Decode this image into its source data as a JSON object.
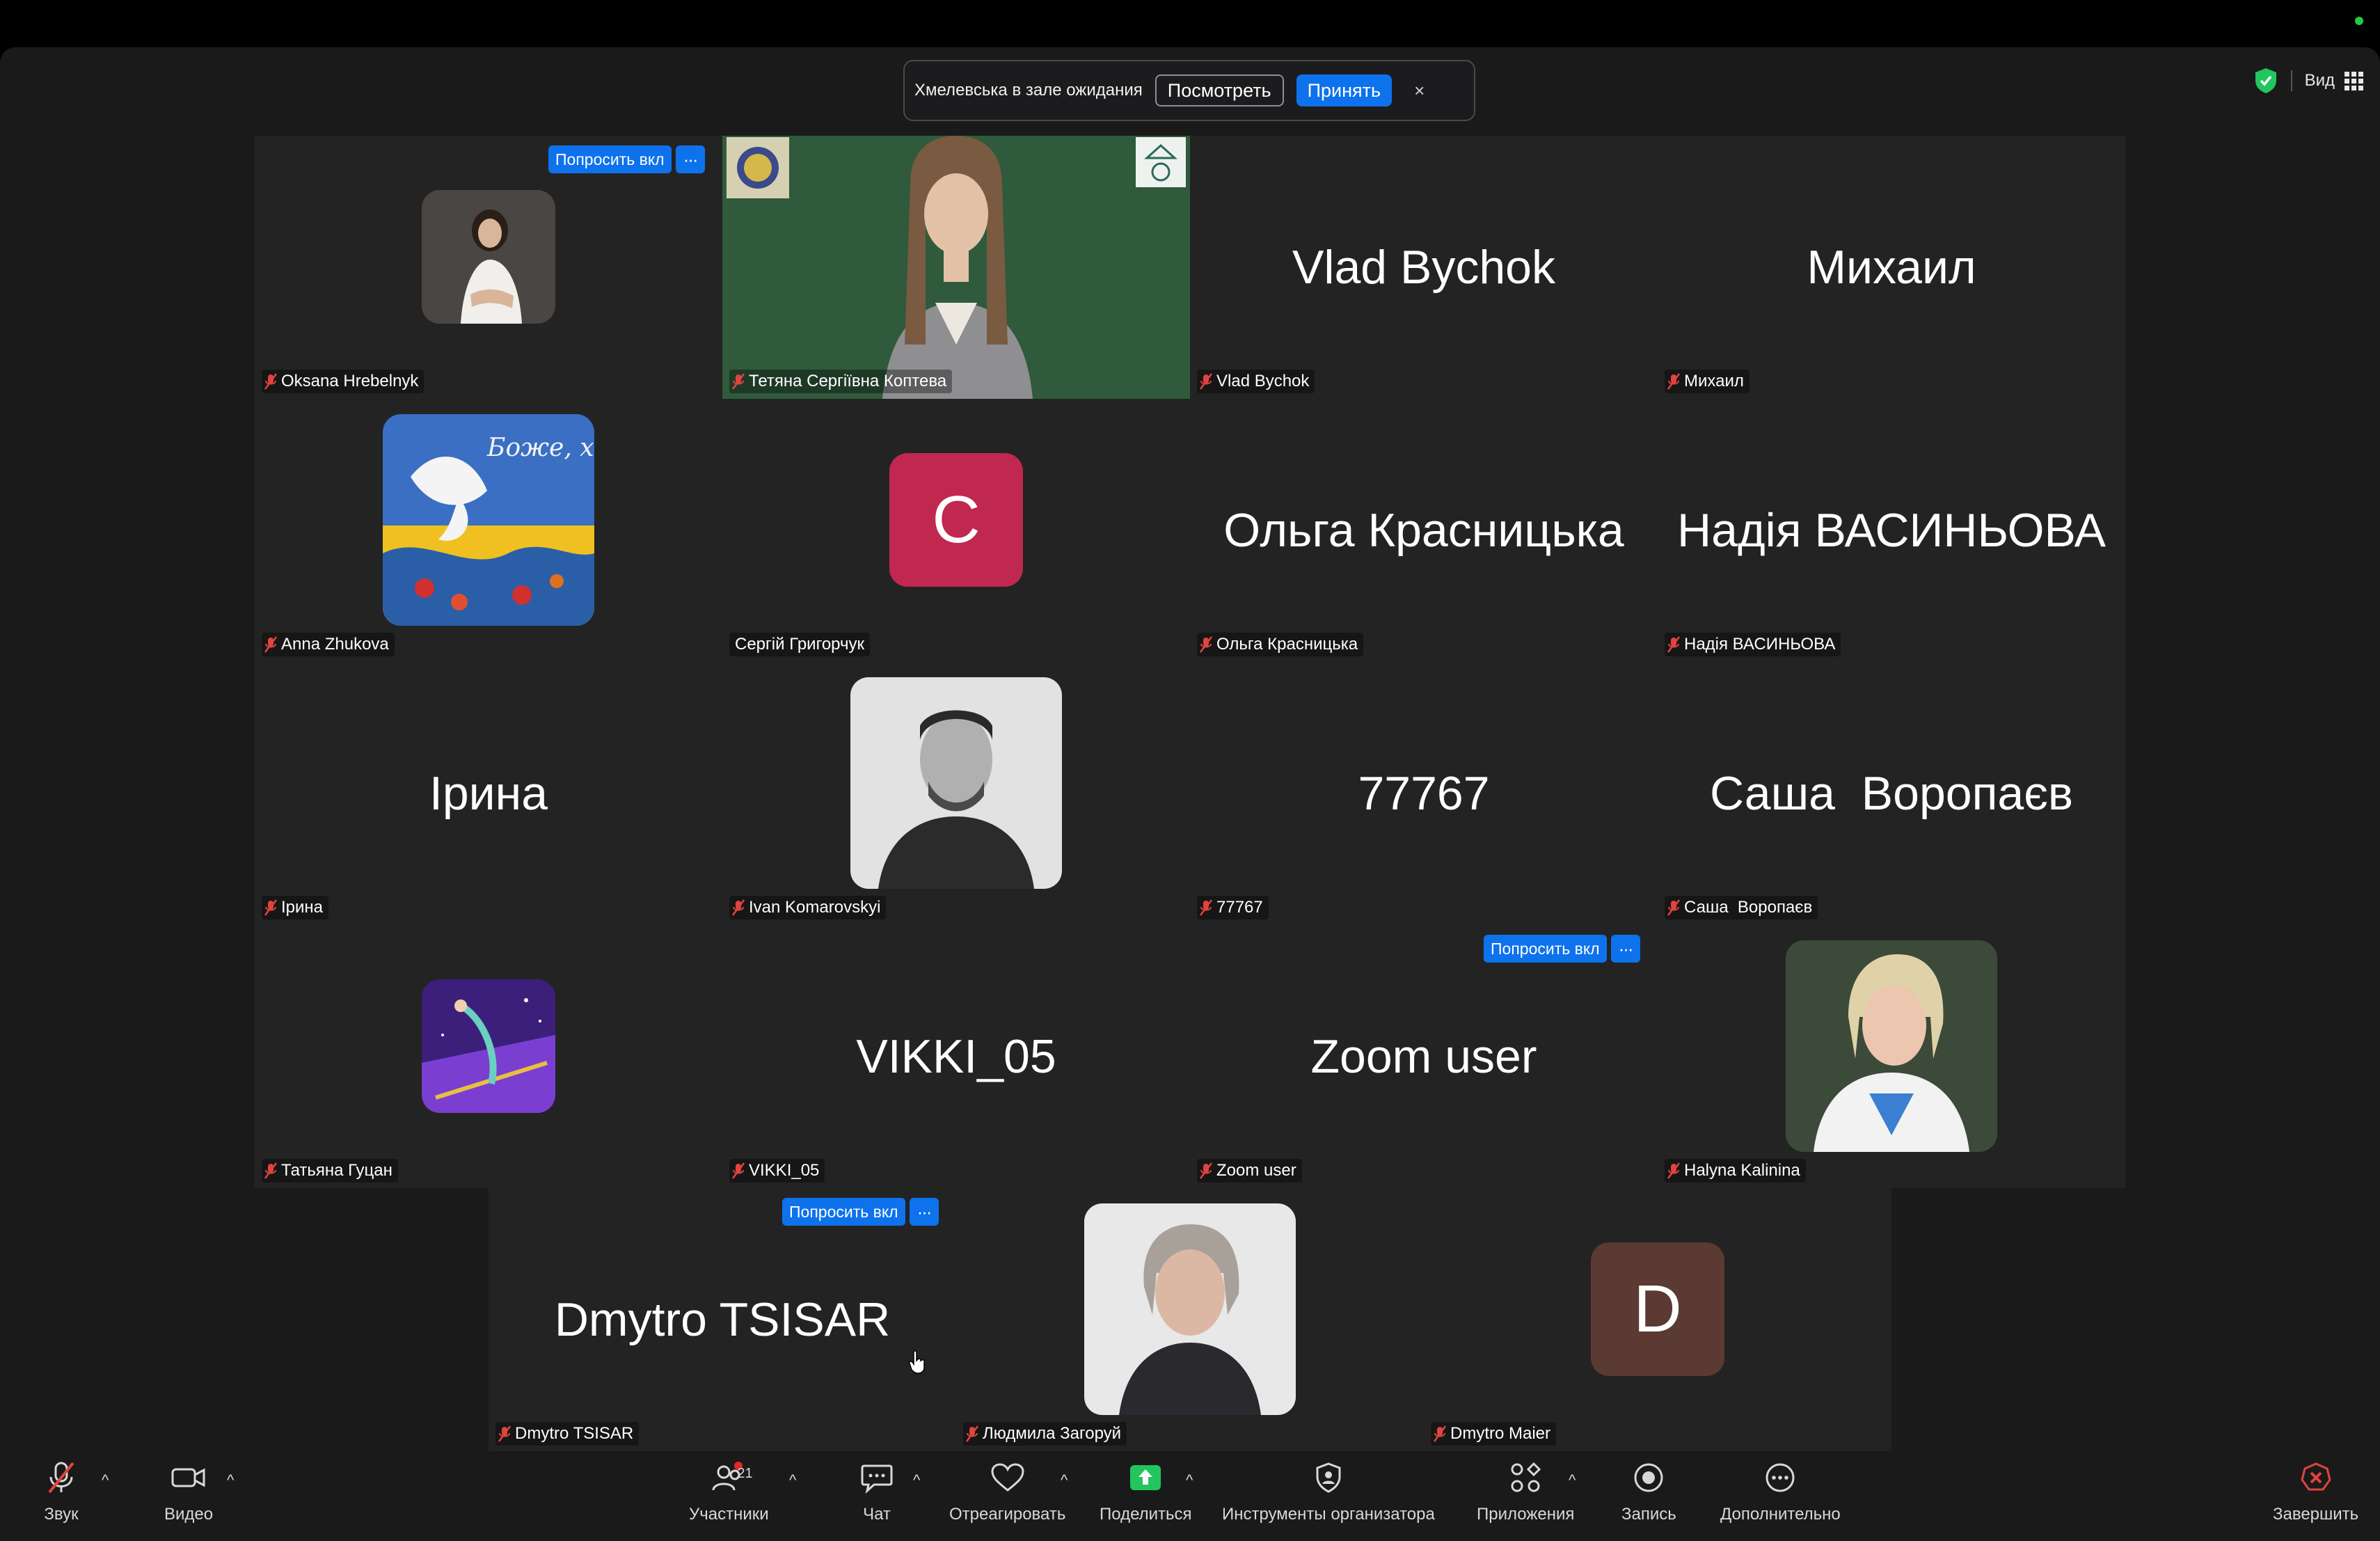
{
  "waiting_room": {
    "message": "Хмелевська в зале ожидания",
    "view_label": "Посмотреть",
    "accept_label": "Принять",
    "close_label": "×"
  },
  "view": {
    "label": "Вид"
  },
  "ask_button_label": "Попросить вкл",
  "ask_more_label": "···",
  "participants": [
    {
      "name": "Oksana Hrebelnyk",
      "display": "",
      "tile": "photo",
      "muted": true
    },
    {
      "name": "Тетяна Сергіївна Коптева",
      "display": "",
      "tile": "video",
      "muted": true
    },
    {
      "name": "Vlad Bychok",
      "display": "Vlad Bychok",
      "tile": "name",
      "muted": true
    },
    {
      "name": "Михаил",
      "display": "Михаил",
      "tile": "name",
      "muted": true
    },
    {
      "name": "Anna Zhukova",
      "display": "",
      "tile": "photo",
      "muted": true
    },
    {
      "name": "Сергій Григорчук",
      "display": "C",
      "tile": "letter",
      "muted": false
    },
    {
      "name": "Ольга Красницька",
      "display": "Ольга Красницька",
      "tile": "name",
      "muted": true
    },
    {
      "name": "Надія ВАСИНЬОВА",
      "display": "Надія ВАСИНЬОВА",
      "tile": "name",
      "muted": true
    },
    {
      "name": "Ірина",
      "display": "Ірина",
      "tile": "name",
      "muted": true
    },
    {
      "name": "Ivan Komarovskyi",
      "display": "",
      "tile": "photo",
      "muted": true
    },
    {
      "name": "77767",
      "display": "77767",
      "tile": "name",
      "muted": true
    },
    {
      "name": "Саша  Воропаєв",
      "display": "Саша  Воропаєв",
      "tile": "name",
      "muted": true
    },
    {
      "name": "Татьяна Гуцан",
      "display": "",
      "tile": "photo",
      "muted": true
    },
    {
      "name": "VIKKI_05",
      "display": "VIKKI_05",
      "tile": "name",
      "muted": true
    },
    {
      "name": "Zoom user",
      "display": "Zoom user",
      "tile": "name",
      "muted": true
    },
    {
      "name": "Halyna Kalinina",
      "display": "",
      "tile": "photo",
      "muted": true
    },
    {
      "name": "Dmytro TSISAR",
      "display": "Dmytro TSISAR",
      "tile": "name",
      "muted": true
    },
    {
      "name": "Людмила Загоруй",
      "display": "",
      "tile": "photo",
      "muted": true
    },
    {
      "name": "Dmytro Maier",
      "display": "D",
      "tile": "letter",
      "muted": true
    }
  ],
  "dove_caption": "Боже, храни Укра",
  "toolbar": {
    "audio": "Звук",
    "video": "Видео",
    "participants": "Участники",
    "participants_count": "21",
    "chat": "Чат",
    "react": "Отреагировать",
    "share": "Поделиться",
    "host_tools": "Инструменты организатора",
    "apps": "Приложения",
    "record": "Запись",
    "more": "Дополнительно",
    "end": "Завершить",
    "caret": "^"
  },
  "colors": {
    "accent": "#0e72ed",
    "mute_red": "#e0443e",
    "share_green": "#22c55e",
    "letter_c": "#c0284f",
    "letter_d": "#5a3a32",
    "video_bg": "#2f5a3c"
  }
}
